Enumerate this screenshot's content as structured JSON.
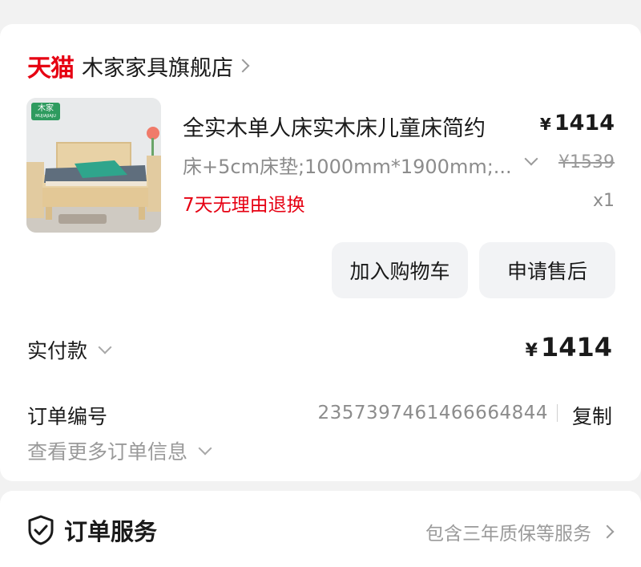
{
  "shop": {
    "brand": "天猫",
    "name": "木家家具旗舰店"
  },
  "product": {
    "thumbnail_tag": "木家",
    "thumbnail_tag_sub": "MUJIAJIAJU",
    "title": "全实木单人床实木床儿童床简约",
    "spec": "床+5cm床垫;1000mm*1900mm;...",
    "policy": "7天无理由退换",
    "currency": "¥",
    "price": "1414",
    "original_price": "¥1539",
    "quantity": "x1"
  },
  "actions": {
    "add_to_cart": "加入购物车",
    "after_sales": "申请售后"
  },
  "payment": {
    "label": "实付款",
    "currency": "¥",
    "amount": "1414"
  },
  "order": {
    "number_label": "订单编号",
    "number": "2357397461466664844",
    "copy_label": "复制",
    "more_info": "查看更多订单信息"
  },
  "service": {
    "title": "订单服务",
    "description": "包含三年质保等服务"
  },
  "colors": {
    "brand_red": "#e60012",
    "text_primary": "#1a1a1a",
    "text_secondary": "#8c8c8c",
    "button_bg": "#f2f3f5",
    "page_bg": "#f2f2f2"
  }
}
